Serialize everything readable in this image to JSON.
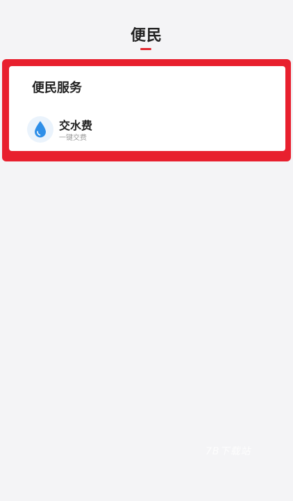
{
  "header": {
    "title": "便民"
  },
  "section": {
    "title": "便民服务",
    "items": [
      {
        "name": "交水费",
        "desc": "一键交费",
        "icon": "water-drop-icon"
      }
    ]
  },
  "watermark": "7B下载站",
  "colors": {
    "accent": "#e0262d",
    "frame": "#e8202e",
    "icon_bg": "#eaf3fc",
    "icon": "#2f8fe8"
  }
}
